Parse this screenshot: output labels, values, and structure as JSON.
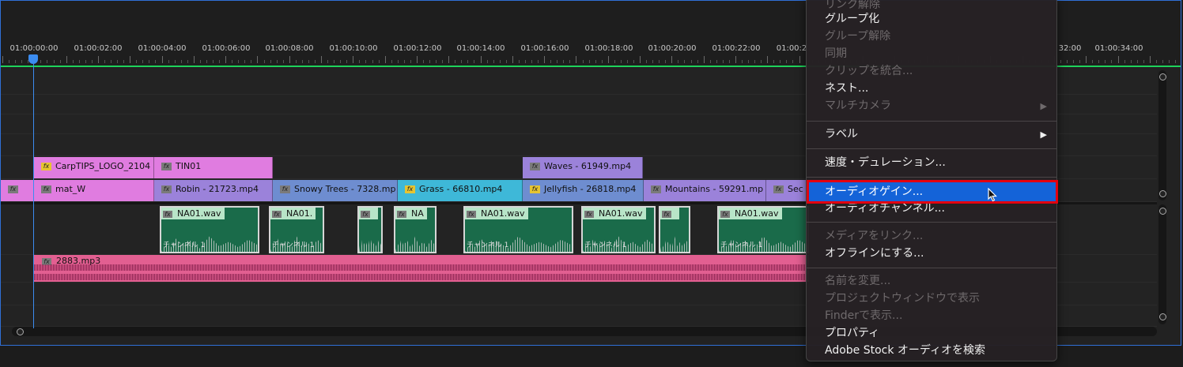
{
  "ruler": {
    "timecodes": [
      "01:00:00:00",
      "01:00:02:00",
      "01:00:04:00",
      "01:00:06:00",
      "01:00:08:00",
      "01:00:10:00",
      "01:00:12:00",
      "01:00:14:00",
      "01:00:16:00",
      "01:00:18:00",
      "01:00:20:00",
      "01:00:22:00",
      "01:00:2",
      "32:00",
      "01:00:34:00"
    ]
  },
  "tracks": {
    "v2": {
      "clips": [
        {
          "name": "CarpTIPS_LOGO_2104",
          "color": "#e07ce0"
        },
        {
          "name": "TIN01",
          "color": "#e07ce0"
        },
        {
          "name": "Waves - 61949.mp4",
          "color": "#9b82da"
        }
      ]
    },
    "v1": {
      "clips": [
        {
          "name": "",
          "color": "#e07ce0"
        },
        {
          "name": "mat_W",
          "color": "#e07ce0"
        },
        {
          "name": "Robin - 21723.mp4",
          "color": "#9b82da"
        },
        {
          "name": "Snowy Trees - 7328.mp",
          "color": "#6e8dd0"
        },
        {
          "name": "Grass - 66810.mp4",
          "color": "#3eb8d8"
        },
        {
          "name": "Jellyfish - 26818.mp4",
          "color": "#6e8dd0"
        },
        {
          "name": "Mountains - 59291.mp",
          "color": "#9b82da"
        },
        {
          "name": "Sec",
          "color": "#9b82da"
        }
      ]
    },
    "a1": {
      "clips": [
        {
          "name": "NA01.wav",
          "channel": "チャンネル 1"
        },
        {
          "name": "NA01.",
          "channel": "チャンネル 1"
        },
        {
          "name": "",
          "channel": ""
        },
        {
          "name": "NA",
          "channel": ""
        },
        {
          "name": "NA01.wav",
          "channel": "チャンネル 1"
        },
        {
          "name": "NA01.wav",
          "channel": "チャンネル 1"
        },
        {
          "name": "",
          "channel": ""
        },
        {
          "name": "NA01.wav",
          "channel": "チャンネル 1"
        }
      ]
    },
    "a2": {
      "clip_name": "2883.mp3",
      "color": "#e25f91"
    }
  },
  "context_menu": {
    "items": [
      {
        "label": "リンク解除",
        "disabled": true
      },
      {
        "label": "グループ化",
        "disabled": false
      },
      {
        "label": "グループ解除",
        "disabled": true
      },
      {
        "label": "同期",
        "disabled": true
      },
      {
        "label": "クリップを統合...",
        "disabled": true
      },
      {
        "label": "ネスト...",
        "disabled": false
      },
      {
        "label": "マルチカメラ",
        "disabled": true,
        "submenu": "▶"
      },
      {
        "label": "ラベル",
        "disabled": false,
        "submenu": "▶"
      },
      {
        "label": "速度・デュレーション...",
        "disabled": false
      },
      {
        "label": "オーディオゲイン...",
        "disabled": false,
        "highlighted": true
      },
      {
        "label": "オーディオチャンネル...",
        "disabled": false
      },
      {
        "label": "メディアをリンク...",
        "disabled": true
      },
      {
        "label": "オフラインにする...",
        "disabled": false
      },
      {
        "label": "名前を変更...",
        "disabled": true
      },
      {
        "label": "プロジェクトウィンドウで表示",
        "disabled": true
      },
      {
        "label": "Finderで表示...",
        "disabled": true
      },
      {
        "label": "プロパティ",
        "disabled": false
      },
      {
        "label": "Adobe Stock オーディオを検索",
        "disabled": false
      }
    ]
  },
  "icons": {
    "fx": "fx",
    "cursor": "arrow-cursor-icon"
  },
  "colors": {
    "accent": "#1463d8",
    "highlight_box": "#e3000f",
    "playhead": "#3b8cf0",
    "work_area": "#1ed35b"
  }
}
